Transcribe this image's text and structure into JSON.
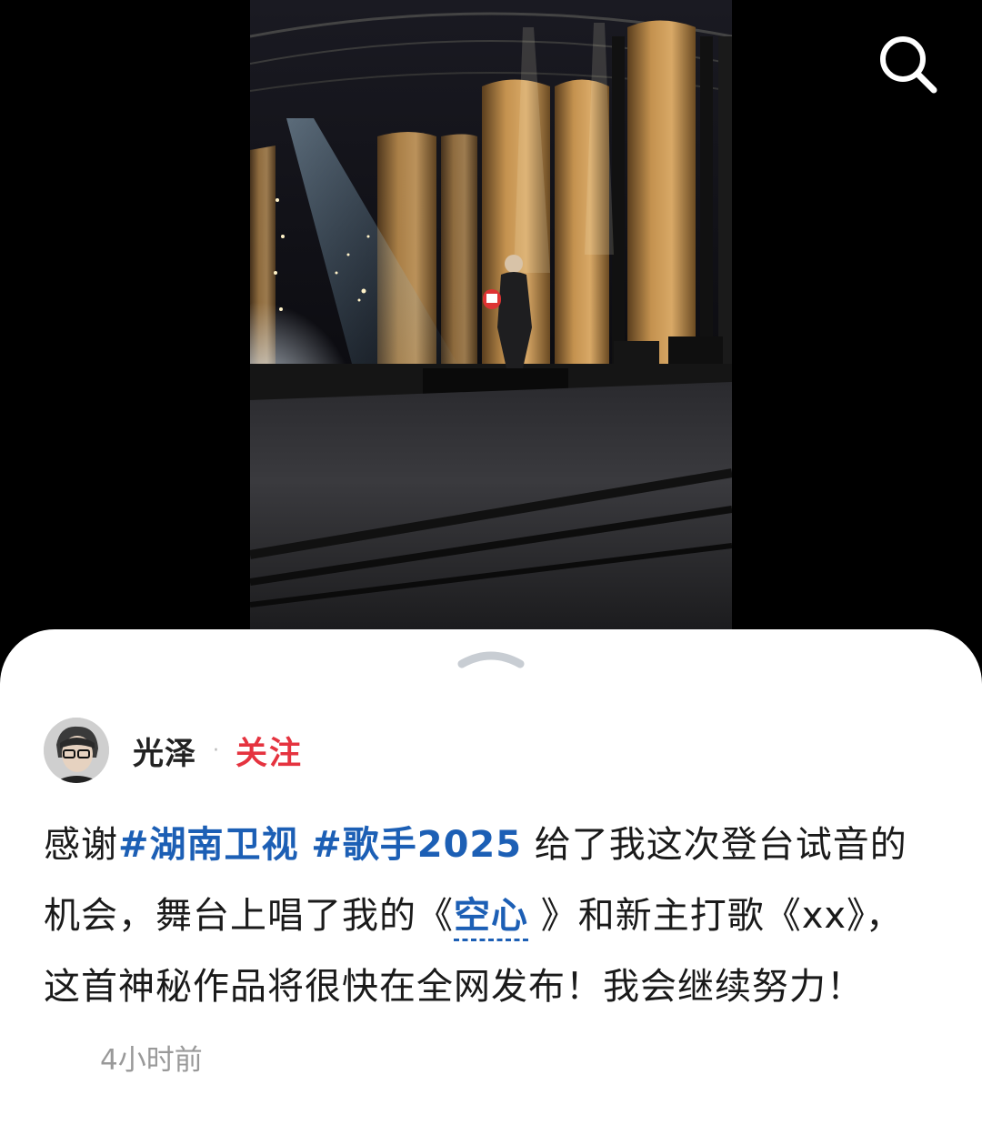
{
  "header": {
    "search_icon": "search-icon"
  },
  "photo": {
    "subject": "stage-photo"
  },
  "sheet": {
    "handle_icon": "chevron-up-icon"
  },
  "post": {
    "author": {
      "name": "光泽",
      "separator": "·",
      "follow_label": "关注"
    },
    "text": {
      "prefix": "感谢",
      "topic_1": "#湖南卫视",
      "space": " ",
      "topic_2": "#歌手2025",
      "part_2": " 给了我这次登台试音的机会，舞台上唱了我的《",
      "song_link": "空心",
      "part_3": " 》和新主打歌《xx》，这首神秘作品将很快在全网发布！我会继续努力！"
    },
    "timestamp": "4小时前"
  },
  "colors": {
    "topic_blue": "#1c5fb5",
    "follow_red": "#e5333f",
    "timestamp_gray": "#999999"
  }
}
